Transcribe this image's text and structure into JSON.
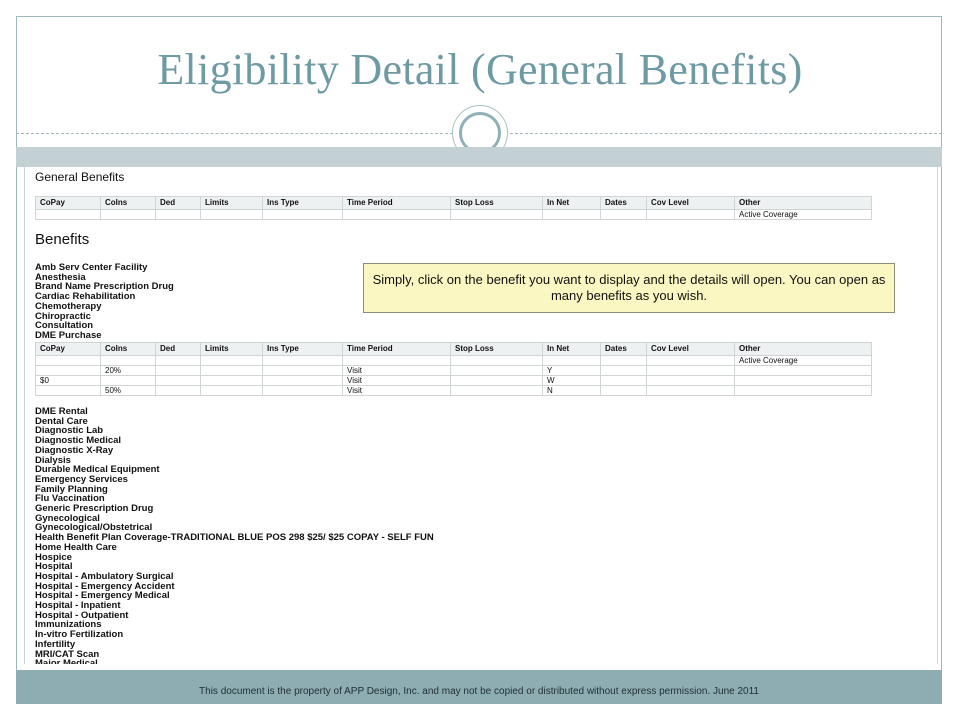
{
  "slide": {
    "title": "Eligibility Detail (General Benefits)",
    "footer": "This document is the property of APP Design, Inc. and may not be copied or distributed without express permission.  June 2011"
  },
  "screen": {
    "general_benefits": {
      "title": "General Benefits",
      "columns": [
        "CoPay",
        "CoIns",
        "Ded",
        "Limits",
        "Ins Type",
        "Time Period",
        "Stop Loss",
        "In Net",
        "Dates",
        "Cov Level",
        "Other"
      ],
      "rows": [
        [
          "",
          "",
          "",
          "",
          "",
          "",
          "",
          "",
          "",
          "",
          "Active Coverage"
        ]
      ]
    },
    "benefits": {
      "title": "Benefits",
      "list_top": [
        "Amb Serv Center Facility",
        "Anesthesia",
        "Brand Name Prescription Drug",
        "Cardiac Rehabilitation",
        "Chemotherapy",
        "Chiropractic",
        "Consultation",
        "DME Purchase"
      ],
      "detail": {
        "columns": [
          "CoPay",
          "CoIns",
          "Ded",
          "Limits",
          "Ins Type",
          "Time Period",
          "Stop Loss",
          "In Net",
          "Dates",
          "Cov Level",
          "Other"
        ],
        "rows": [
          [
            "",
            "",
            "",
            "",
            "",
            "",
            "",
            "",
            "",
            "",
            "Active Coverage"
          ],
          [
            "",
            "20%",
            "",
            "",
            "",
            "Visit",
            "",
            "Y",
            "",
            "",
            ""
          ],
          [
            "$0",
            "",
            "",
            "",
            "",
            "Visit",
            "",
            "W",
            "",
            "",
            ""
          ],
          [
            "",
            "50%",
            "",
            "",
            "",
            "Visit",
            "",
            "N",
            "",
            "",
            ""
          ]
        ]
      },
      "list_bottom": [
        "DME Rental",
        "Dental Care",
        "Diagnostic Lab",
        "Diagnostic Medical",
        "Diagnostic X-Ray",
        "Dialysis",
        "Durable Medical Equipment",
        "Emergency Services",
        "Family Planning",
        "Flu Vaccination",
        "Generic Prescription Drug",
        "Gynecological",
        "Gynecological/Obstetrical",
        "Health Benefit Plan Coverage-TRADITIONAL BLUE POS 298 $25/ $25 COPAY - SELF FUN",
        "Home Health Care",
        "Hospice",
        "Hospital",
        "Hospital - Ambulatory Surgical",
        "Hospital - Emergency Accident",
        "Hospital - Emergency Medical",
        "Hospital - Inpatient",
        "Hospital - Outpatient",
        "Immunizations",
        "In-vitro Fertilization",
        "Infertility",
        "MRI/CAT Scan",
        "Major Medical"
      ]
    },
    "callout": "Simply, click on the benefit you want to display and the details will open.  You can open as many benefits as you wish."
  },
  "colors": {
    "title": "#6e9aa3",
    "band_top": "#c3d0d4",
    "band_bottom": "#8eadb3",
    "callout_bg": "#fbf7c2"
  }
}
